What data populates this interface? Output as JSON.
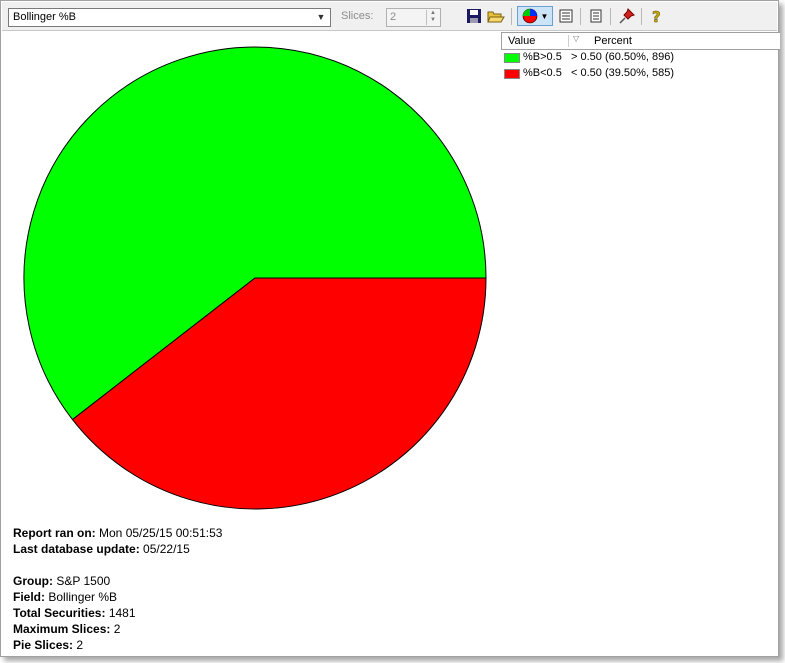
{
  "toolbar": {
    "field_value": "Bollinger %B",
    "slices_label": "Slices:",
    "slices_value": "2",
    "colors": {
      "save": "#1a1a60",
      "pin": "#d02020",
      "help": "#c8a800"
    }
  },
  "legend": {
    "header_value": "Value",
    "header_percent": "Percent",
    "rows": [
      {
        "value": "%B>0.5",
        "percent": "> 0.50 (60.50%, 896)",
        "color": "#00ff00"
      },
      {
        "value": "%B<0.5",
        "percent": "< 0.50 (39.50%, 585)",
        "color": "#ff0000"
      }
    ]
  },
  "chart_data": {
    "type": "pie",
    "slices": [
      {
        "label": "%B>0.5",
        "percent": 60.5,
        "count": 896,
        "color": "#00ff00"
      },
      {
        "label": "%B<0.5",
        "percent": 39.5,
        "count": 585,
        "color": "#ff0000"
      }
    ],
    "legend_placement": "top-right"
  },
  "report": {
    "ran_on_label": "Report ran on:",
    "ran_on_value": "Mon 05/25/15 00:51:53",
    "db_update_label": "Last database update:",
    "db_update_value": "05/22/15",
    "group_label": "Group:",
    "group_value": "S&P 1500",
    "field_label": "Field:",
    "field_value": "Bollinger %B",
    "total_label": "Total Securities:",
    "total_value": "1481",
    "max_slices_label": "Maximum Slices:",
    "max_slices_value": "2",
    "pie_slices_label": "Pie Slices:",
    "pie_slices_value": "2"
  }
}
